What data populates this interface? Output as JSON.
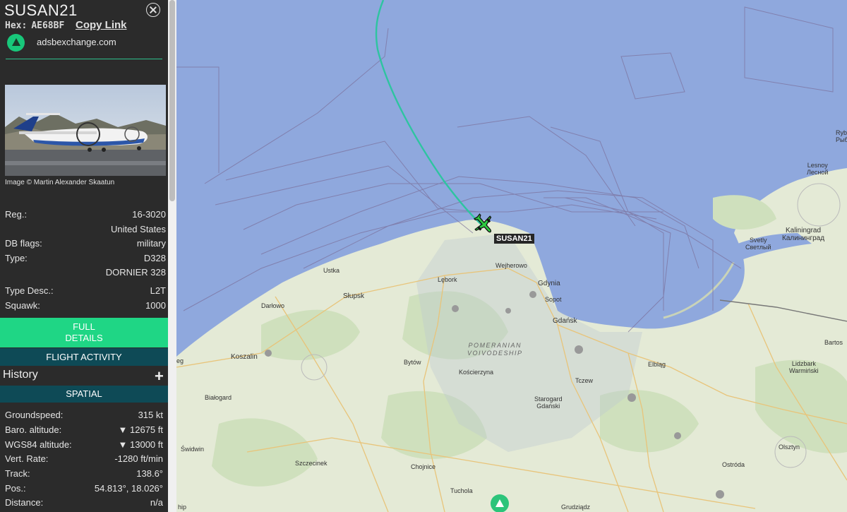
{
  "colors": {
    "accent": "#1fd685",
    "header_bar": "#0e4a56",
    "sea": "#8fa8dd",
    "land": "#e4ead6",
    "track": "#2ec4a0",
    "aircraft": "#2ecc40"
  },
  "aircraft": {
    "callsign": "SUSAN21",
    "hex_label": "Hex:",
    "hex": "AE68BF",
    "copy_link": "Copy Link",
    "site": "adsbexchange.com",
    "image_credit": "Image © Martin Alexander Skaatun",
    "details": [
      {
        "label": "Reg.:",
        "value": "16-3020"
      },
      {
        "label": "",
        "value": "United States"
      },
      {
        "label": "DB flags:",
        "value": "military"
      },
      {
        "label": "Type:",
        "value": "D328"
      },
      {
        "label": "",
        "value": "DORNIER 328"
      },
      {
        "label": "Type Desc.:",
        "value": "L2T"
      },
      {
        "label": "Squawk:",
        "value": "1000"
      }
    ]
  },
  "buttons": {
    "full_details_1": "FULL",
    "full_details_2": "DETAILS",
    "flight_activity": "FLIGHT ACTIVITY"
  },
  "history": {
    "title": "History",
    "plus": "+"
  },
  "spatial": {
    "title": "SPATIAL",
    "rows": [
      {
        "label": "Groundspeed:",
        "value": "315 kt"
      },
      {
        "label": "Baro. altitude:",
        "value": "▼ 12675 ft"
      },
      {
        "label": "WGS84 altitude:",
        "value": "▼ 13000 ft"
      },
      {
        "label": "Vert. Rate:",
        "value": "-1280 ft/min"
      },
      {
        "label": "Track:",
        "value": "138.6°"
      },
      {
        "label": "Pos.:",
        "value": "54.813°, 18.026°"
      },
      {
        "label": "Distance:",
        "value": "n/a"
      }
    ]
  },
  "map": {
    "flight_label": "SUSAN21",
    "places": {
      "ustka": "Ustka",
      "slupsk": "Słupsk",
      "darlowo": "Darłowo",
      "koszalin": "Koszalin",
      "bialogard": "Białogard",
      "swidwin": "Świdwin",
      "szczecinek": "Szczecinek",
      "chojnice": "Chojnice",
      "tuchola": "Tuchola",
      "bytow": "Bytów",
      "koscierzyna": "Kościerzyna",
      "lebork": "Lębork",
      "wejherowo": "Wejherowo",
      "gdynia": "Gdynia",
      "sopot": "Sopot",
      "gdansk": "Gdańsk",
      "tczew": "Tczew",
      "starogard_1": "Starogard",
      "starogard_2": "Gdański",
      "elblag": "Elbląg",
      "region_1": "POMERANIAN",
      "region_2": "VOIVODESHIP",
      "grudziadz": "Grudziądz",
      "ostroda": "Ostróda",
      "olsztyn": "Olsztyn",
      "lidzbark_1": "Lidzbark",
      "lidzbark_2": "Warmiński",
      "bartos": "Bartos",
      "kaliningrad_1": "Kaliningrad",
      "kaliningrad_2": "Калининград",
      "svetly_1": "Svetly",
      "svetly_2": "Светлый",
      "lesnoy_1": "Lesnoy",
      "lesnoy_2": "Лесной",
      "ryb_1": "Ryb",
      "ryb_2": "Рыб",
      "edge_hip": "hip",
      "edge_eg": "eg"
    }
  }
}
